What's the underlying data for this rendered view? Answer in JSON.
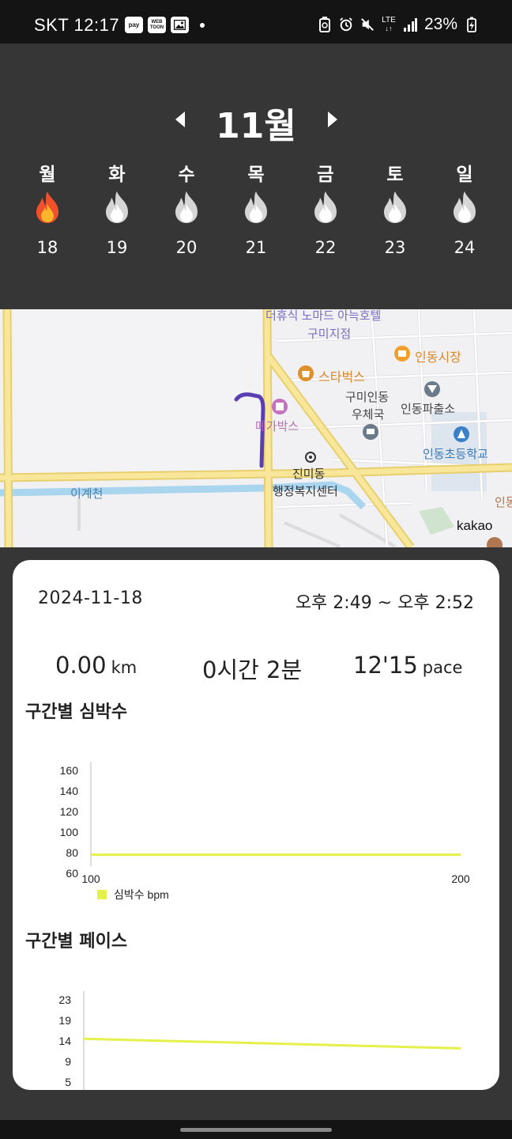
{
  "status_bar": {
    "carrier_time": "SKT 12:17",
    "apps": [
      "pay",
      "WEB TOON"
    ],
    "battery": "23%",
    "network": "LTE"
  },
  "week": {
    "month": "11월",
    "days": [
      {
        "name": "월",
        "date": "18",
        "active": true
      },
      {
        "name": "화",
        "date": "19",
        "active": false
      },
      {
        "name": "수",
        "date": "20",
        "active": false
      },
      {
        "name": "목",
        "date": "21",
        "active": false
      },
      {
        "name": "금",
        "date": "22",
        "active": false
      },
      {
        "name": "토",
        "date": "23",
        "active": false
      },
      {
        "name": "일",
        "date": "24",
        "active": false
      }
    ]
  },
  "map": {
    "labels": {
      "hotel_line1": "더휴식 노마드 아늑호텔",
      "hotel_line2": "구미지점",
      "market": "인동시장",
      "starbucks": "스타벅스",
      "post1": "구미인동",
      "post2": "우체국",
      "police": "인동파출소",
      "megabox": "메가박스",
      "school": "인동초등학교",
      "center1": "진미동",
      "center2": "행정복지센터",
      "stream": "이계천",
      "edge": "인동",
      "provider": "kakao"
    }
  },
  "record": {
    "date": "2024-11-18",
    "time_range": "오후 2:49 ~ 오후 2:52",
    "distance": "0.00",
    "distance_unit": "km",
    "duration": "0시간 2분",
    "pace": "12'15",
    "pace_unit": "pace"
  },
  "heart_section_title": "구간별 심박수",
  "pace_section_title": "구간별 페이스",
  "chart_data": [
    {
      "type": "line",
      "title": "구간별 심박수",
      "x": [
        100,
        200
      ],
      "x_ticks": [
        "100",
        "200"
      ],
      "series": [
        {
          "name": "심박수 bpm",
          "color": "#e6f04a",
          "values": [
            72,
            72
          ]
        }
      ],
      "y_ticks": [
        "160",
        "140",
        "120",
        "100",
        "80",
        "60"
      ],
      "ylim": [
        60,
        170
      ],
      "grid": false,
      "legend": "bottom-left"
    },
    {
      "type": "line",
      "title": "구간별 페이스",
      "x": [
        0,
        1
      ],
      "series": [
        {
          "color": "#e6f04a",
          "values": [
            16.3,
            14.1
          ]
        }
      ],
      "y_ticks": [
        "23",
        "19",
        "14",
        "9",
        "5"
      ],
      "ylim": [
        4.5,
        27.3
      ],
      "grid": false
    }
  ]
}
